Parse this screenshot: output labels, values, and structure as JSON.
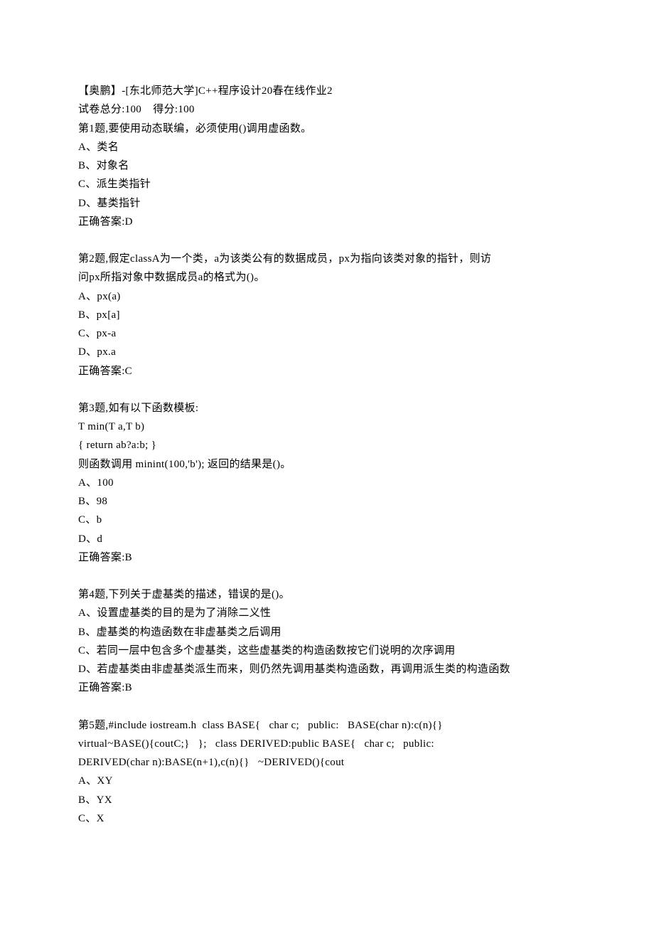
{
  "header": {
    "title": "【奥鹏】-[东北师范大学]C++程序设计20春在线作业2",
    "score_line": "试卷总分:100    得分:100"
  },
  "q1": {
    "stem": "第1题,要使用动态联编，必须使用()调用虚函数。",
    "a": "A、类名",
    "b": "B、对象名",
    "c": "C、派生类指针",
    "d": "D、基类指针",
    "ans": "正确答案:D"
  },
  "q2": {
    "stem1": "第2题,假定classA为一个类，a为该类公有的数据成员，px为指向该类对象的指针，则访",
    "stem2": "问px所指对象中数据成员a的格式为()。",
    "a": "A、px(a)",
    "b": "B、px[a]",
    "c": "C、px-a",
    "d": "D、px.a",
    "ans": "正确答案:C"
  },
  "q3": {
    "l1": "第3题,如有以下函数模板:",
    "l2": "T min(T a,T b)",
    "l3": "{ return ab?a:b; }",
    "l4": "则函数调用 minint(100,'b'); 返回的结果是()。",
    "a": "A、100",
    "b": "B、98",
    "c": "C、b",
    "d": "D、d",
    "ans": "正确答案:B"
  },
  "q4": {
    "stem": "第4题,下列关于虚基类的描述，错误的是()。",
    "a": "A、设置虚基类的目的是为了消除二义性",
    "b": "B、虚基类的构造函数在非虚基类之后调用",
    "c": "C、若同一层中包含多个虚基类，这些虚基类的构造函数按它们说明的次序调用",
    "d": "D、若虚基类由非虚基类派生而来，则仍然先调用基类构造函数，再调用派生类的构造函数",
    "ans": "正确答案:B"
  },
  "q5": {
    "l1": "第5题,#include iostream.h  class BASE{   char c;   public:   BASE(char n):c(n){}   ",
    "l2": "virtual~BASE(){coutC;}   };   class DERIVED:public BASE{   char c;   public:   ",
    "l3": "DERIVED(char n):BASE(n+1),c(n){}   ~DERIVED(){cout",
    "a": "A、XY",
    "b": "B、YX",
    "c": "C、X"
  }
}
